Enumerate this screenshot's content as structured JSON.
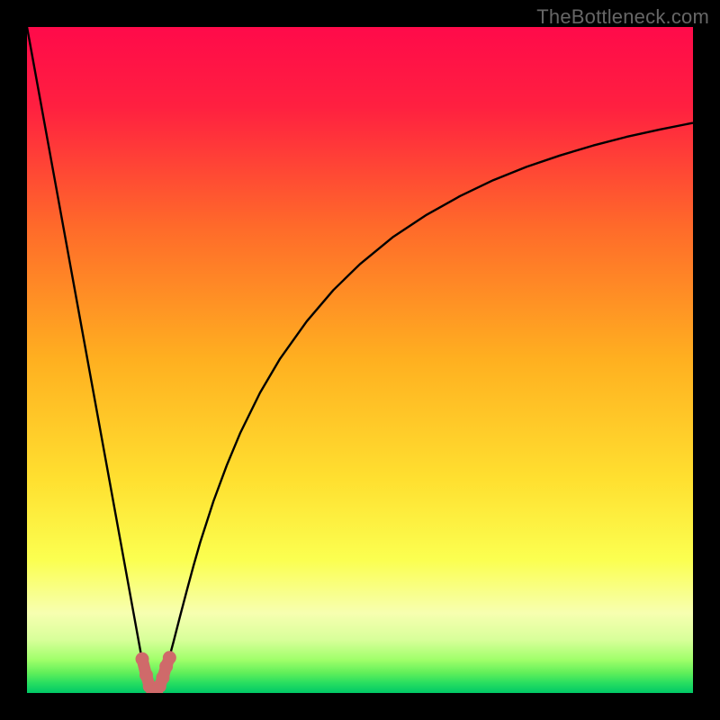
{
  "watermark": "TheBottleneck.com",
  "chart_data": {
    "type": "line",
    "title": "",
    "xlabel": "",
    "ylabel": "",
    "xlim": [
      0,
      100
    ],
    "ylim": [
      0,
      100
    ],
    "background_gradient_stops": [
      {
        "pos": 0.0,
        "color": "#ff0a4a"
      },
      {
        "pos": 0.12,
        "color": "#ff2040"
      },
      {
        "pos": 0.3,
        "color": "#ff6a2a"
      },
      {
        "pos": 0.5,
        "color": "#ffb020"
      },
      {
        "pos": 0.68,
        "color": "#ffe030"
      },
      {
        "pos": 0.8,
        "color": "#fbff50"
      },
      {
        "pos": 0.88,
        "color": "#f7ffb0"
      },
      {
        "pos": 0.92,
        "color": "#d8ff9a"
      },
      {
        "pos": 0.95,
        "color": "#a0ff6a"
      },
      {
        "pos": 0.97,
        "color": "#60ef5a"
      },
      {
        "pos": 0.985,
        "color": "#28de60"
      },
      {
        "pos": 1.0,
        "color": "#00c866"
      }
    ],
    "series": [
      {
        "name": "bottleneck-curve",
        "stroke": "#000000",
        "x": [
          0,
          2,
          4,
          6,
          8,
          10,
          12,
          14,
          15,
          16,
          16.6,
          17.2,
          17.8,
          18.4,
          18.8,
          19.2,
          19.6,
          20,
          20.6,
          21.2,
          22,
          23,
          24,
          25,
          26,
          28,
          30,
          32,
          35,
          38,
          42,
          46,
          50,
          55,
          60,
          65,
          70,
          75,
          80,
          85,
          90,
          95,
          100
        ],
        "y": [
          100,
          89.0,
          78.0,
          67.0,
          56.0,
          45.0,
          34.0,
          23.0,
          17.5,
          12.0,
          8.7,
          5.4,
          2.9,
          1.1,
          0.35,
          0.0,
          0.35,
          1.1,
          2.7,
          4.7,
          7.7,
          11.6,
          15.4,
          19.1,
          22.6,
          28.8,
          34.2,
          39.0,
          45.1,
          50.2,
          55.8,
          60.5,
          64.4,
          68.5,
          71.8,
          74.6,
          77.0,
          79.0,
          80.7,
          82.2,
          83.5,
          84.6,
          85.6
        ]
      },
      {
        "name": "dip-marker",
        "type": "scatter",
        "stroke": "#cf6a6a",
        "fill": "#cf6a6a",
        "points": [
          {
            "x": 17.3,
            "y": 5.1
          },
          {
            "x": 17.9,
            "y": 2.7
          },
          {
            "x": 18.4,
            "y": 1.0
          },
          {
            "x": 18.9,
            "y": 0.2
          },
          {
            "x": 19.4,
            "y": 0.2
          },
          {
            "x": 19.9,
            "y": 1.0
          },
          {
            "x": 20.4,
            "y": 2.3
          },
          {
            "x": 20.9,
            "y": 4.0
          },
          {
            "x": 21.4,
            "y": 5.3
          }
        ]
      }
    ]
  }
}
